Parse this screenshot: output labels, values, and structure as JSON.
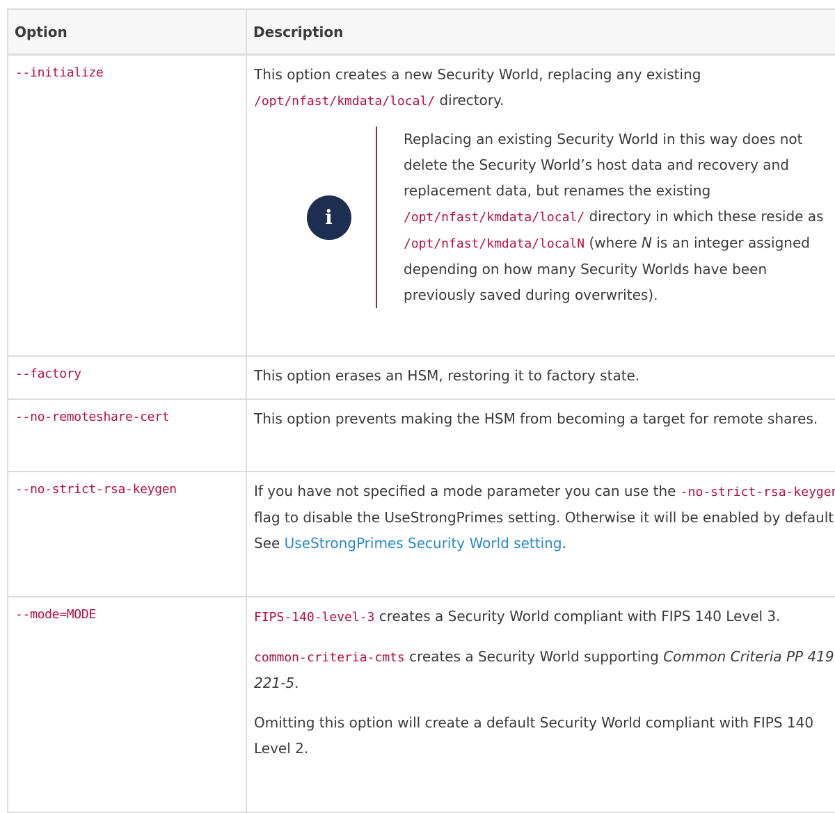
{
  "table": {
    "headers": {
      "option": "Option",
      "description": "Description"
    },
    "rows": {
      "initialize": {
        "option": "--initialize",
        "text1": "This option creates a new Security World, replacing any existing ",
        "code1": "/opt/nfast/kmdata/local/",
        "text2": " directory.",
        "note": {
          "icon": "info-icon",
          "t1": "Replacing an existing Security World in this way does not delete the Security World’s host data and recovery and replacement data, but renames the existing ",
          "c1": "/opt/nfast/kmdata/local/",
          "t2": " directory in which these reside as ",
          "c2": "/opt/nfast/kmdata/localN",
          "t3": " (where ",
          "em1": "N",
          "t4": " is an integer assigned depending on how many Security Worlds have been previously saved during overwrites)."
        }
      },
      "factory": {
        "option": "--factory",
        "text": "This option erases an HSM, restoring it to factory state."
      },
      "no_remoteshare": {
        "option": "--no-remoteshare-cert",
        "text": "This option prevents making the HSM from becoming a target for remote shares."
      },
      "no_strict": {
        "option": "--no-strict-rsa-keygen",
        "t1": "If you have not specified a mode parameter you can use the ",
        "c1": "-no-strict-rsa-keygen",
        "t2": " flag to disable the UseStrongPrimes setting. Otherwise it will be enabled by default. See ",
        "link": "UseStrongPrimes Security World setting",
        "t3": "."
      },
      "mode": {
        "option": "--mode=MODE",
        "p1c": "FIPS-140-level-3",
        "p1t": " creates a Security World compliant with FIPS 140 Level 3.",
        "p2c": "common-criteria-cmts",
        "p2t": " creates a Security World supporting ",
        "p2em": "Common Criteria PP 419 221-5",
        "p2end": ".",
        "p3": "Omitting this option will create a default Security World compliant with FIPS 140 Level 2."
      }
    }
  }
}
